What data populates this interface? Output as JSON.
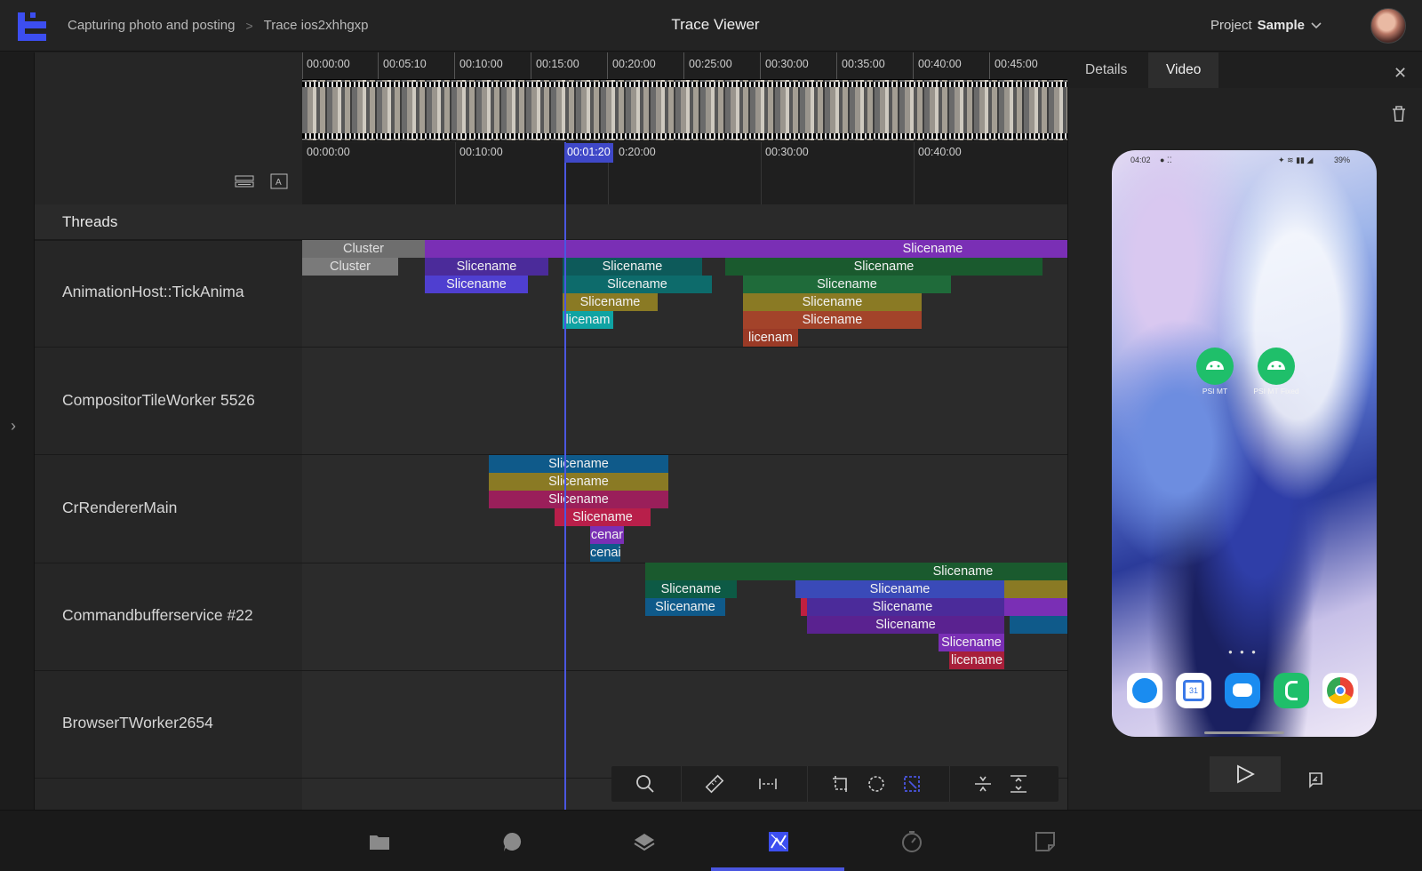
{
  "header": {
    "breadcrumb": [
      "Capturing photo and posting",
      "Trace ios2xhhgxp"
    ],
    "title": "Trace Viewer",
    "project_prefix": "Project",
    "project_name": "Sample"
  },
  "timeline": {
    "top_ticks": [
      "00:00:00",
      "00:05:10",
      "00:10:00",
      "00:15:00",
      "00:20:00",
      "00:25:00",
      "00:30:00",
      "00:35:00",
      "00:40:00",
      "00:45:00"
    ],
    "zoom_ticks": [
      "00:00:00",
      "00:10:00",
      "0:20:00",
      "00:30:00",
      "00:40:00"
    ],
    "playhead": "00:01:20"
  },
  "threads": {
    "heading": "Threads",
    "rows": [
      {
        "label": "AnimationHost::TickAnima"
      },
      {
        "label": "CompositorTileWorker 5526"
      },
      {
        "label": "CrRendererMain"
      },
      {
        "label": "Commandbufferservice #22"
      },
      {
        "label": "BrowserTWorker2654"
      }
    ]
  },
  "slices": {
    "cluster": "Cluster",
    "slicename": "Slicename",
    "trunc_a": "licenam",
    "trunc_b": "licenam",
    "trunc_c": "cenar",
    "trunc_d": "cenai",
    "trunc_e": "licename"
  },
  "panel": {
    "tabs": [
      "Details",
      "Video"
    ],
    "active_tab": "Video",
    "phone": {
      "time": "04:02",
      "battery": "39%",
      "apps": [
        "PSI MT",
        "PSI MT Fixed"
      ]
    }
  },
  "colors": {
    "accent": "#4a56e0",
    "purple": "#7a2fb5",
    "indigo": "#4b3bb8",
    "teal": "#0d6b6b",
    "green": "#1f6b3a",
    "olive": "#8a7a24",
    "rust": "#a3432a",
    "crimson": "#a81f4a",
    "blue": "#0f5a8a"
  }
}
